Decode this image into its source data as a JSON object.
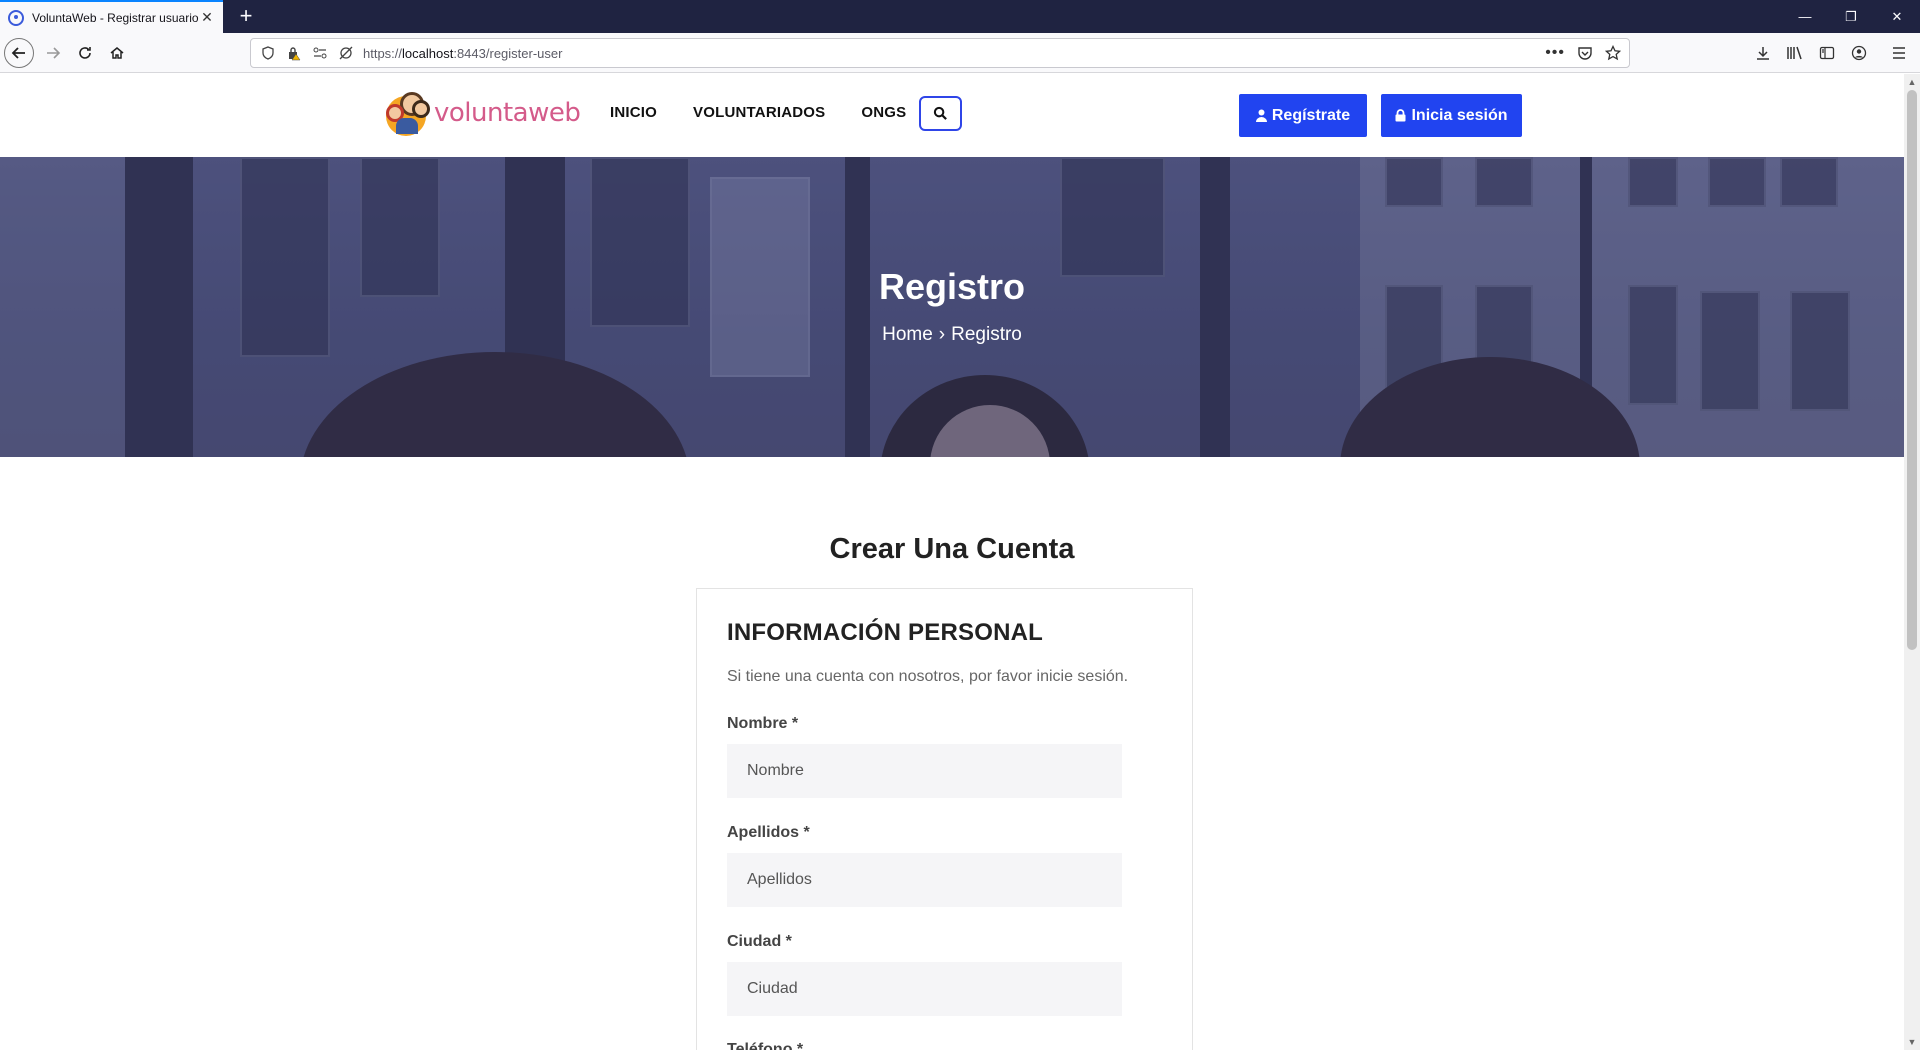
{
  "browser": {
    "tab_title": "VoluntaWeb - Registrar usuario",
    "url_scheme": "https://",
    "url_host": "localhost",
    "url_rest": ":8443/register-user"
  },
  "header": {
    "logo_text": "voluntaweb",
    "menu": [
      "INICIO",
      "VOLUNTARIADOS",
      "ONGS"
    ],
    "register_label": "Regístrate",
    "login_label": "Inicia sesión"
  },
  "hero": {
    "title": "Registro",
    "breadcrumb_home": "Home",
    "breadcrumb_sep": "›",
    "breadcrumb_current": "Registro"
  },
  "main": {
    "section_title": "Crear Una Cuenta",
    "card_title": "INFORMACIÓN PERSONAL",
    "lead": "Si tiene una cuenta con nosotros, por favor inicie sesión.",
    "fields": [
      {
        "label": "Nombre *",
        "placeholder": "Nombre",
        "value": ""
      },
      {
        "label": "Apellidos *",
        "placeholder": "Apellidos",
        "value": ""
      },
      {
        "label": "Ciudad *",
        "placeholder": "Ciudad",
        "value": ""
      },
      {
        "label": "Teléfono *",
        "placeholder": "",
        "value": ""
      }
    ]
  },
  "colors": {
    "primary": "#2144f0",
    "logo_pink": "#d45b8a",
    "tabbar": "#1f2341"
  }
}
